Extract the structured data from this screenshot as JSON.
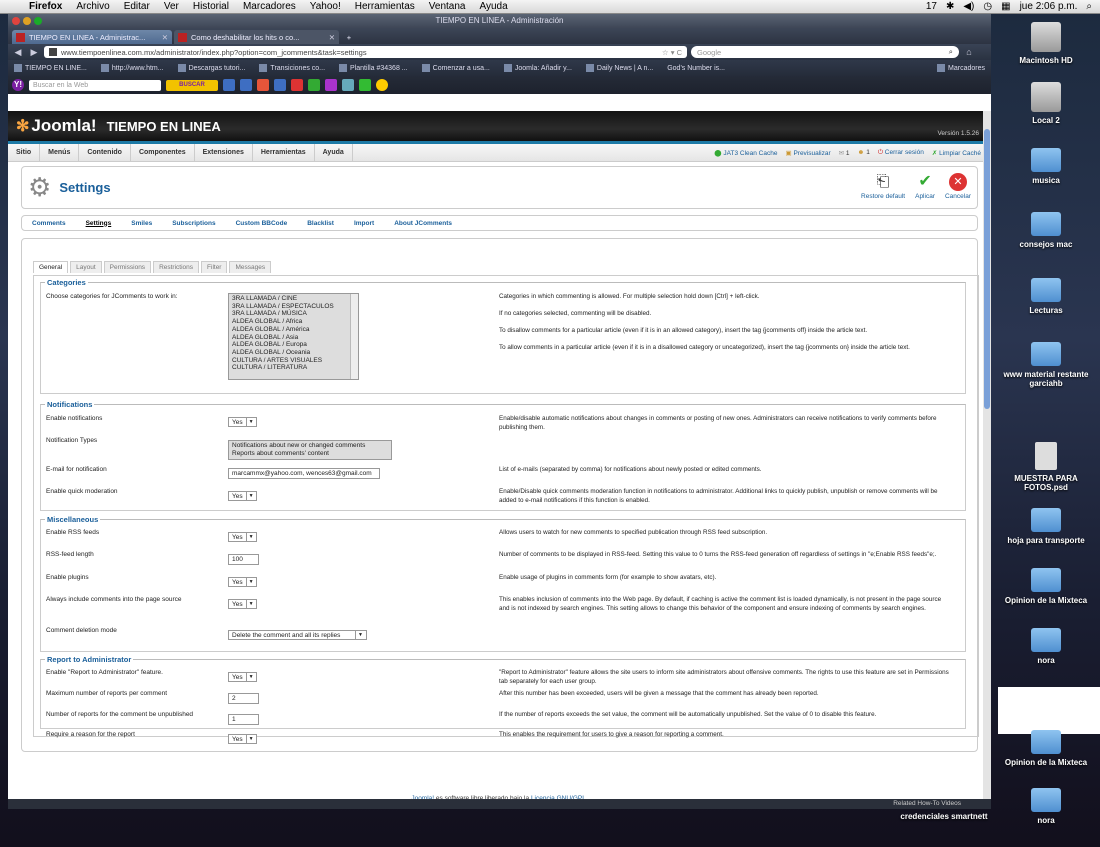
{
  "menubar": {
    "app": "Firefox",
    "items": [
      "Archivo",
      "Editar",
      "Ver",
      "Historial",
      "Marcadores",
      "Yahoo!",
      "Herramientas",
      "Ventana",
      "Ayuda"
    ],
    "status_num": "17",
    "clock": "jue 2:06 p.m."
  },
  "browser": {
    "window_title": "TIEMPO EN LINEA - Administración",
    "tabs": [
      {
        "label": "TIEMPO EN LINEA - Administrac...",
        "x": "✕"
      },
      {
        "label": "Como deshabilitar los hits o co...",
        "x": "✕"
      }
    ],
    "new_tab": "+",
    "url": "www.tiempoenlinea.com.mx/administrator/index.php?option=com_jcomments&task=settings",
    "search_engine": "Google",
    "bookmarks": [
      "TIEMPO EN LINE...",
      "http://www.htm...",
      "Descargas tutori...",
      "Transiciones co...",
      "Plantilla #34368 ...",
      "Comenzar a usa...",
      "Joomla: Añadir y...",
      "Daily News | A n...",
      "God's Number is...",
      "Marcadores"
    ],
    "yahoo_placeholder": "Buscar en la Web",
    "yahoo_button": "BUSCAR"
  },
  "joomla": {
    "logo": "Joomla!",
    "site": "TIEMPO EN LINEA",
    "version": "Versión 1.5.26",
    "menu": [
      "Sitio",
      "Menús",
      "Contenido",
      "Componentes",
      "Extensiones",
      "Herramientas",
      "Ayuda"
    ],
    "menu_right": {
      "clean_cache": "JAT3 Clean Cache",
      "preview": "Previsualizar",
      "count1": "1",
      "count2": "1",
      "logout": "Cerrar sesión",
      "clear_cache": "Limpiar Caché"
    },
    "page_title": "Settings",
    "toolbar": {
      "restore": "Restore default",
      "apply": "Aplicar",
      "cancel": "Cancelar"
    },
    "subnav": [
      "Comments",
      "Settings",
      "Smiles",
      "Subscriptions",
      "Custom BBCode",
      "Blacklist",
      "Import",
      "About JComments"
    ],
    "tabs": [
      "General",
      "Layout",
      "Permissions",
      "Restrictions",
      "Filter",
      "Messages"
    ],
    "footer_brand": "Joomla!",
    "footer_text": " es software libre liberado bajo la ",
    "footer_link": "Licencia GNU/GPL",
    "footer_end": ".",
    "statusbar": "Related How-To Videos"
  },
  "sections": {
    "categories": {
      "title": "Categories",
      "label": "Choose categories for JComments to work in:",
      "options": [
        "3RA LLAMADA / CINE",
        "3RA LLAMADA / ESPECTACULOS",
        "3RA LLAMADA / MÚSICA",
        "ALDEA GLOBAL / Africa",
        "ALDEA GLOBAL / América",
        "ALDEA GLOBAL / Asia",
        "ALDEA GLOBAL / Europa",
        "ALDEA GLOBAL / Oceania",
        "CULTURA / ARTES VISUALES",
        "CULTURA / LITERATURA"
      ],
      "desc": [
        "Categories in which commenting is allowed. For multiple selection hold down [Ctrl] + left-click.",
        "If no categories selected, commenting will be disabled.",
        "To disallow comments for a particular article (even if it is in an allowed category), insert the tag {jcomments off} inside the article text.",
        "To allow comments in a particular article (even if it is in a disallowed category or uncategorized), insert the tag {jcomments on} inside the article text."
      ]
    },
    "notifications": {
      "title": "Notifications",
      "enable_label": "Enable notifications",
      "enable_value": "Yes",
      "enable_desc": "Enable/disable automatic notifications about changes in comments or posting of new ones. Administrators can receive notifications to verify comments before publishing them.",
      "types_label": "Notification Types",
      "types": [
        "Notifications about new or changed comments",
        "Reports about comments' content"
      ],
      "email_label": "E-mail for notification",
      "email_value": "marcammx@yahoo.com, wences63@gmail.com",
      "email_desc": "List of e-mails (separated by comma) for notifications about newly posted or edited comments.",
      "quick_label": "Enable quick moderation",
      "quick_value": "Yes",
      "quick_desc": "Enable/Disable quick comments moderation function in notifications to administrator. Additional links to quickly publish, unpublish or remove comments will be added to e-mail notifications if this function is enabled."
    },
    "misc": {
      "title": "Miscellaneous",
      "rss_label": "Enable RSS feeds",
      "rss_value": "Yes",
      "rss_desc": "Allows users to watch for new comments to specified publication through RSS feed subscription.",
      "rsslen_label": "RSS-feed length",
      "rsslen_value": "100",
      "rsslen_desc": "Number of comments to be displayed in RSS-feed. Setting this value to 0 turns the RSS-feed generation off regardless of settings in \"e;Enable RSS feeds\"e;.",
      "plugins_label": "Enable plugins",
      "plugins_value": "Yes",
      "plugins_desc": "Enable usage of plugins in comments form (for example to show avatars, etc).",
      "include_label": "Always include comments into the page source",
      "include_value": "Yes",
      "include_desc": "This enables inclusion of comments into the Web page. By default, if caching is active the comment list is loaded dynamically, is not present in the page source and is not indexed by search engines. This setting allows to change this behavior of the component and ensure indexing of comments by search engines.",
      "delete_label": "Comment deletion mode",
      "delete_value": "Delete the comment and all its replies"
    },
    "report": {
      "title": "Report to Administrator",
      "enable_label": "Enable \"Report to Administrator\" feature.",
      "enable_value": "Yes",
      "enable_desc": "\"Report to Administrator\" feature allows the site users to inform site administrators about offensive comments. The rights to use this feature are set in Permissions tab separately for each user group.",
      "max_label": "Maximum number of reports per comment",
      "max_value": "2",
      "max_desc": "After this number has been exceeded, users will be given a message that the comment has already been reported.",
      "unpub_label": "Number of reports for the comment be unpublished",
      "unpub_value": "1",
      "unpub_desc": "If the number of reports exceeds the set value, the comment will be automatically unpublished. Set the value of 0 to disable this feature.",
      "reason_label": "Require a reason for the report",
      "reason_value": "Yes",
      "reason_desc": "This enables the requirement for users to give a reason for reporting a comment."
    }
  },
  "desktop": [
    "Macintosh HD",
    "Local 2",
    "musica",
    "consejos mac",
    "Lecturas",
    "www material restante garciahb",
    "MUESTRA PARA FOTOS.psd",
    "hoja para transporte",
    "Opinion de la Mixteca",
    "nora",
    "Opinion de la Mixteca",
    "credenciales smartnett",
    "nora"
  ]
}
